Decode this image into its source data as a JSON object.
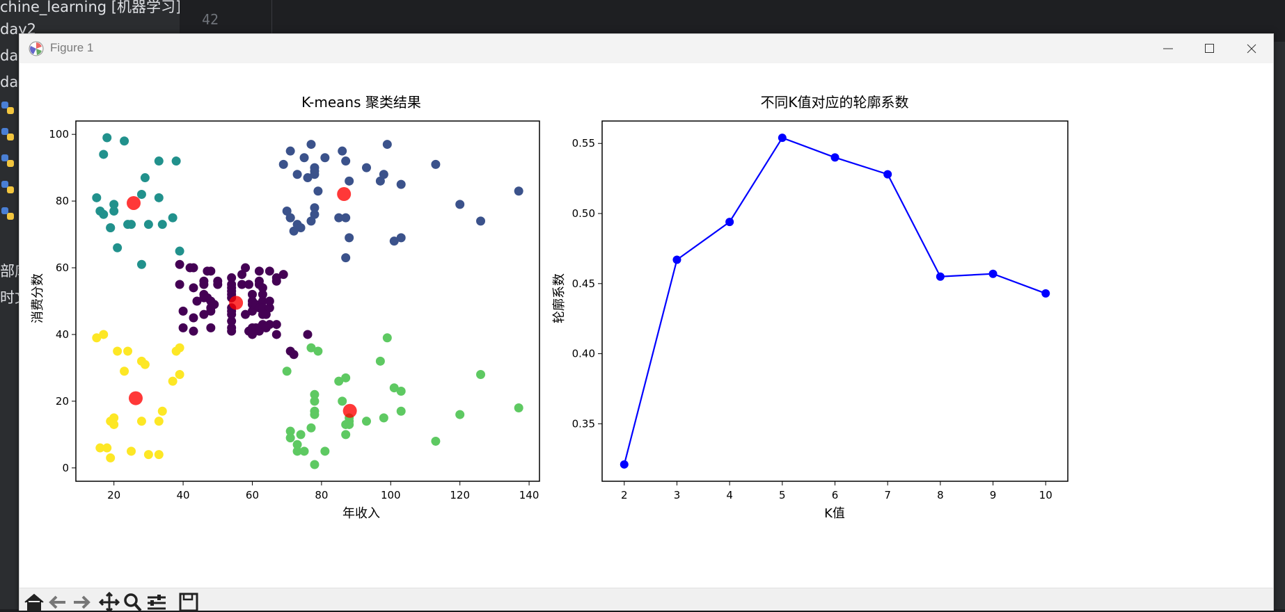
{
  "ide": {
    "project_label": "chine_learning [机器学习]",
    "line_number": "42",
    "sidebar_items": [
      "day2",
      "day",
      "day",
      "部库",
      "时文"
    ]
  },
  "window": {
    "title": "Figure 1",
    "controls": {
      "minimize": "minimize-icon",
      "maximize": "maximize-icon",
      "close": "close-icon"
    }
  },
  "toolbar": {
    "buttons": [
      "home-icon",
      "back-icon",
      "forward-icon",
      "pan-icon",
      "zoom-icon",
      "configure-subplots-icon",
      "save-icon"
    ]
  },
  "colors": {
    "cluster_0": "#440154",
    "cluster_1": "#3b528b",
    "cluster_2": "#21918c",
    "cluster_3": "#5ec962",
    "cluster_4": "#fde725",
    "centroid": "#ff0000",
    "line": "#0000ff"
  },
  "chart_data": [
    {
      "type": "scatter",
      "title": "K-means 聚类结果",
      "xlabel": "年收入",
      "ylabel": "消费分数",
      "xlim": [
        9,
        143
      ],
      "ylim": [
        -4,
        104
      ],
      "xticks": [
        20,
        40,
        60,
        80,
        100,
        120,
        140
      ],
      "yticks": [
        0,
        20,
        40,
        60,
        80,
        100
      ],
      "grid": false,
      "series": [
        {
          "cluster": 0,
          "points": [
            [
              39,
              61
            ],
            [
              39,
              55
            ],
            [
              40,
              47
            ],
            [
              40,
              42
            ],
            [
              42,
              60
            ],
            [
              43,
              60
            ],
            [
              43,
              54
            ],
            [
              43,
              45
            ],
            [
              43,
              41
            ],
            [
              44,
              50
            ],
            [
              46,
              51
            ],
            [
              46,
              46
            ],
            [
              46,
              56
            ],
            [
              46,
              55
            ],
            [
              46,
              52
            ],
            [
              47,
              59
            ],
            [
              47,
              51
            ],
            [
              48,
              59
            ],
            [
              48,
              50
            ],
            [
              48,
              48
            ],
            [
              48,
              47
            ],
            [
              48,
              42
            ],
            [
              49,
              49
            ],
            [
              50,
              55
            ],
            [
              50,
              56
            ],
            [
              54,
              47
            ],
            [
              54,
              54
            ],
            [
              54,
              53
            ],
            [
              54,
              48
            ],
            [
              54,
              52
            ],
            [
              54,
              42
            ],
            [
              54,
              51
            ],
            [
              54,
              55
            ],
            [
              54,
              41
            ],
            [
              54,
              44
            ],
            [
              54,
              57
            ],
            [
              54,
              46
            ],
            [
              57,
              58
            ],
            [
              57,
              55
            ],
            [
              58,
              60
            ],
            [
              58,
              46
            ],
            [
              59,
              55
            ],
            [
              59,
              41
            ],
            [
              60,
              49
            ],
            [
              60,
              40
            ],
            [
              60,
              42
            ],
            [
              60,
              52
            ],
            [
              60,
              47
            ],
            [
              60,
              50
            ],
            [
              61,
              42
            ],
            [
              61,
              49
            ],
            [
              62,
              41
            ],
            [
              62,
              48
            ],
            [
              62,
              59
            ],
            [
              62,
              55
            ],
            [
              62,
              56
            ],
            [
              62,
              42
            ],
            [
              63,
              50
            ],
            [
              63,
              46
            ],
            [
              63,
              43
            ],
            [
              63,
              48
            ],
            [
              63,
              52
            ],
            [
              63,
              54
            ],
            [
              64,
              42
            ],
            [
              64,
              46
            ],
            [
              65,
              48
            ],
            [
              65,
              50
            ],
            [
              65,
              43
            ],
            [
              65,
              59
            ],
            [
              67,
              43
            ],
            [
              67,
              57
            ],
            [
              67,
              56
            ],
            [
              67,
              40
            ],
            [
              69,
              58
            ],
            [
              71,
              35
            ],
            [
              72,
              34
            ],
            [
              76,
              40
            ]
          ]
        },
        {
          "cluster": 1,
          "points": [
            [
              69,
              91
            ],
            [
              70,
              77
            ],
            [
              71,
              95
            ],
            [
              71,
              75
            ],
            [
              71,
              75
            ],
            [
              72,
              71
            ],
            [
              73,
              88
            ],
            [
              73,
              73
            ],
            [
              74,
              72
            ],
            [
              75,
              93
            ],
            [
              76,
              87
            ],
            [
              77,
              97
            ],
            [
              77,
              74
            ],
            [
              78,
              90
            ],
            [
              78,
              88
            ],
            [
              78,
              76
            ],
            [
              78,
              89
            ],
            [
              78,
              78
            ],
            [
              79,
              83
            ],
            [
              81,
              93
            ],
            [
              85,
              75
            ],
            [
              86,
              95
            ],
            [
              87,
              63
            ],
            [
              87,
              75
            ],
            [
              87,
              92
            ],
            [
              88,
              86
            ],
            [
              88,
              69
            ],
            [
              93,
              90
            ],
            [
              97,
              86
            ],
            [
              98,
              88
            ],
            [
              99,
              97
            ],
            [
              101,
              68
            ],
            [
              103,
              85
            ],
            [
              103,
              69
            ],
            [
              113,
              91
            ],
            [
              120,
              79
            ],
            [
              126,
              74
            ],
            [
              137,
              83
            ]
          ]
        },
        {
          "cluster": 2,
          "points": [
            [
              15,
              81
            ],
            [
              16,
              77
            ],
            [
              17,
              76
            ],
            [
              17,
              94
            ],
            [
              18,
              99
            ],
            [
              19,
              72
            ],
            [
              19,
              72
            ],
            [
              20,
              77
            ],
            [
              20,
              79
            ],
            [
              21,
              66
            ],
            [
              23,
              98
            ],
            [
              24,
              73
            ],
            [
              25,
              73
            ],
            [
              28,
              82
            ],
            [
              28,
              61
            ],
            [
              29,
              87
            ],
            [
              30,
              73
            ],
            [
              33,
              92
            ],
            [
              33,
              81
            ],
            [
              34,
              73
            ],
            [
              37,
              75
            ],
            [
              38,
              92
            ],
            [
              39,
              65
            ]
          ]
        },
        {
          "cluster": 3,
          "points": [
            [
              70,
              29
            ],
            [
              71,
              11
            ],
            [
              71,
              9
            ],
            [
              73,
              5
            ],
            [
              73,
              7
            ],
            [
              74,
              10
            ],
            [
              75,
              5
            ],
            [
              77,
              12
            ],
            [
              77,
              36
            ],
            [
              78,
              22
            ],
            [
              78,
              17
            ],
            [
              78,
              20
            ],
            [
              78,
              16
            ],
            [
              78,
              1
            ],
            [
              79,
              35
            ],
            [
              81,
              5
            ],
            [
              85,
              26
            ],
            [
              86,
              20
            ],
            [
              87,
              27
            ],
            [
              87,
              13
            ],
            [
              87,
              10
            ],
            [
              88,
              13
            ],
            [
              88,
              15
            ],
            [
              88,
              14
            ],
            [
              93,
              14
            ],
            [
              97,
              32
            ],
            [
              98,
              15
            ],
            [
              99,
              39
            ],
            [
              101,
              24
            ],
            [
              103,
              17
            ],
            [
              103,
              23
            ],
            [
              113,
              8
            ],
            [
              120,
              16
            ],
            [
              126,
              28
            ],
            [
              137,
              18
            ]
          ]
        },
        {
          "cluster": 4,
          "points": [
            [
              15,
              39
            ],
            [
              16,
              6
            ],
            [
              17,
              40
            ],
            [
              18,
              6
            ],
            [
              19,
              3
            ],
            [
              19,
              14
            ],
            [
              20,
              15
            ],
            [
              20,
              13
            ],
            [
              21,
              35
            ],
            [
              23,
              29
            ],
            [
              24,
              35
            ],
            [
              25,
              5
            ],
            [
              28,
              14
            ],
            [
              28,
              32
            ],
            [
              29,
              31
            ],
            [
              30,
              4
            ],
            [
              33,
              4
            ],
            [
              33,
              14
            ],
            [
              34,
              17
            ],
            [
              37,
              26
            ],
            [
              38,
              35
            ],
            [
              39,
              36
            ],
            [
              39,
              28
            ]
          ]
        }
      ],
      "centroids": [
        [
          55.3,
          49.5
        ],
        [
          86.5,
          82.1
        ],
        [
          25.7,
          79.4
        ],
        [
          88.2,
          17.1
        ],
        [
          26.3,
          20.9
        ]
      ]
    },
    {
      "type": "line",
      "title": "不同K值对应的轮廓系数",
      "xlabel": "K值",
      "ylabel": "轮廓系数",
      "x": [
        2,
        3,
        4,
        5,
        6,
        7,
        8,
        9,
        10
      ],
      "y": [
        0.321,
        0.467,
        0.494,
        0.554,
        0.54,
        0.528,
        0.455,
        0.457,
        0.443
      ],
      "xlim": [
        1.58,
        10.42
      ],
      "ylim": [
        0.309,
        0.566
      ],
      "xticks": [
        2,
        3,
        4,
        5,
        6,
        7,
        8,
        9,
        10
      ],
      "yticks": [
        0.35,
        0.4,
        0.45,
        0.5,
        0.55
      ],
      "ytick_labels": [
        "0.35",
        "0.40",
        "0.45",
        "0.50",
        "0.55"
      ],
      "marker": "o",
      "grid": false
    }
  ]
}
